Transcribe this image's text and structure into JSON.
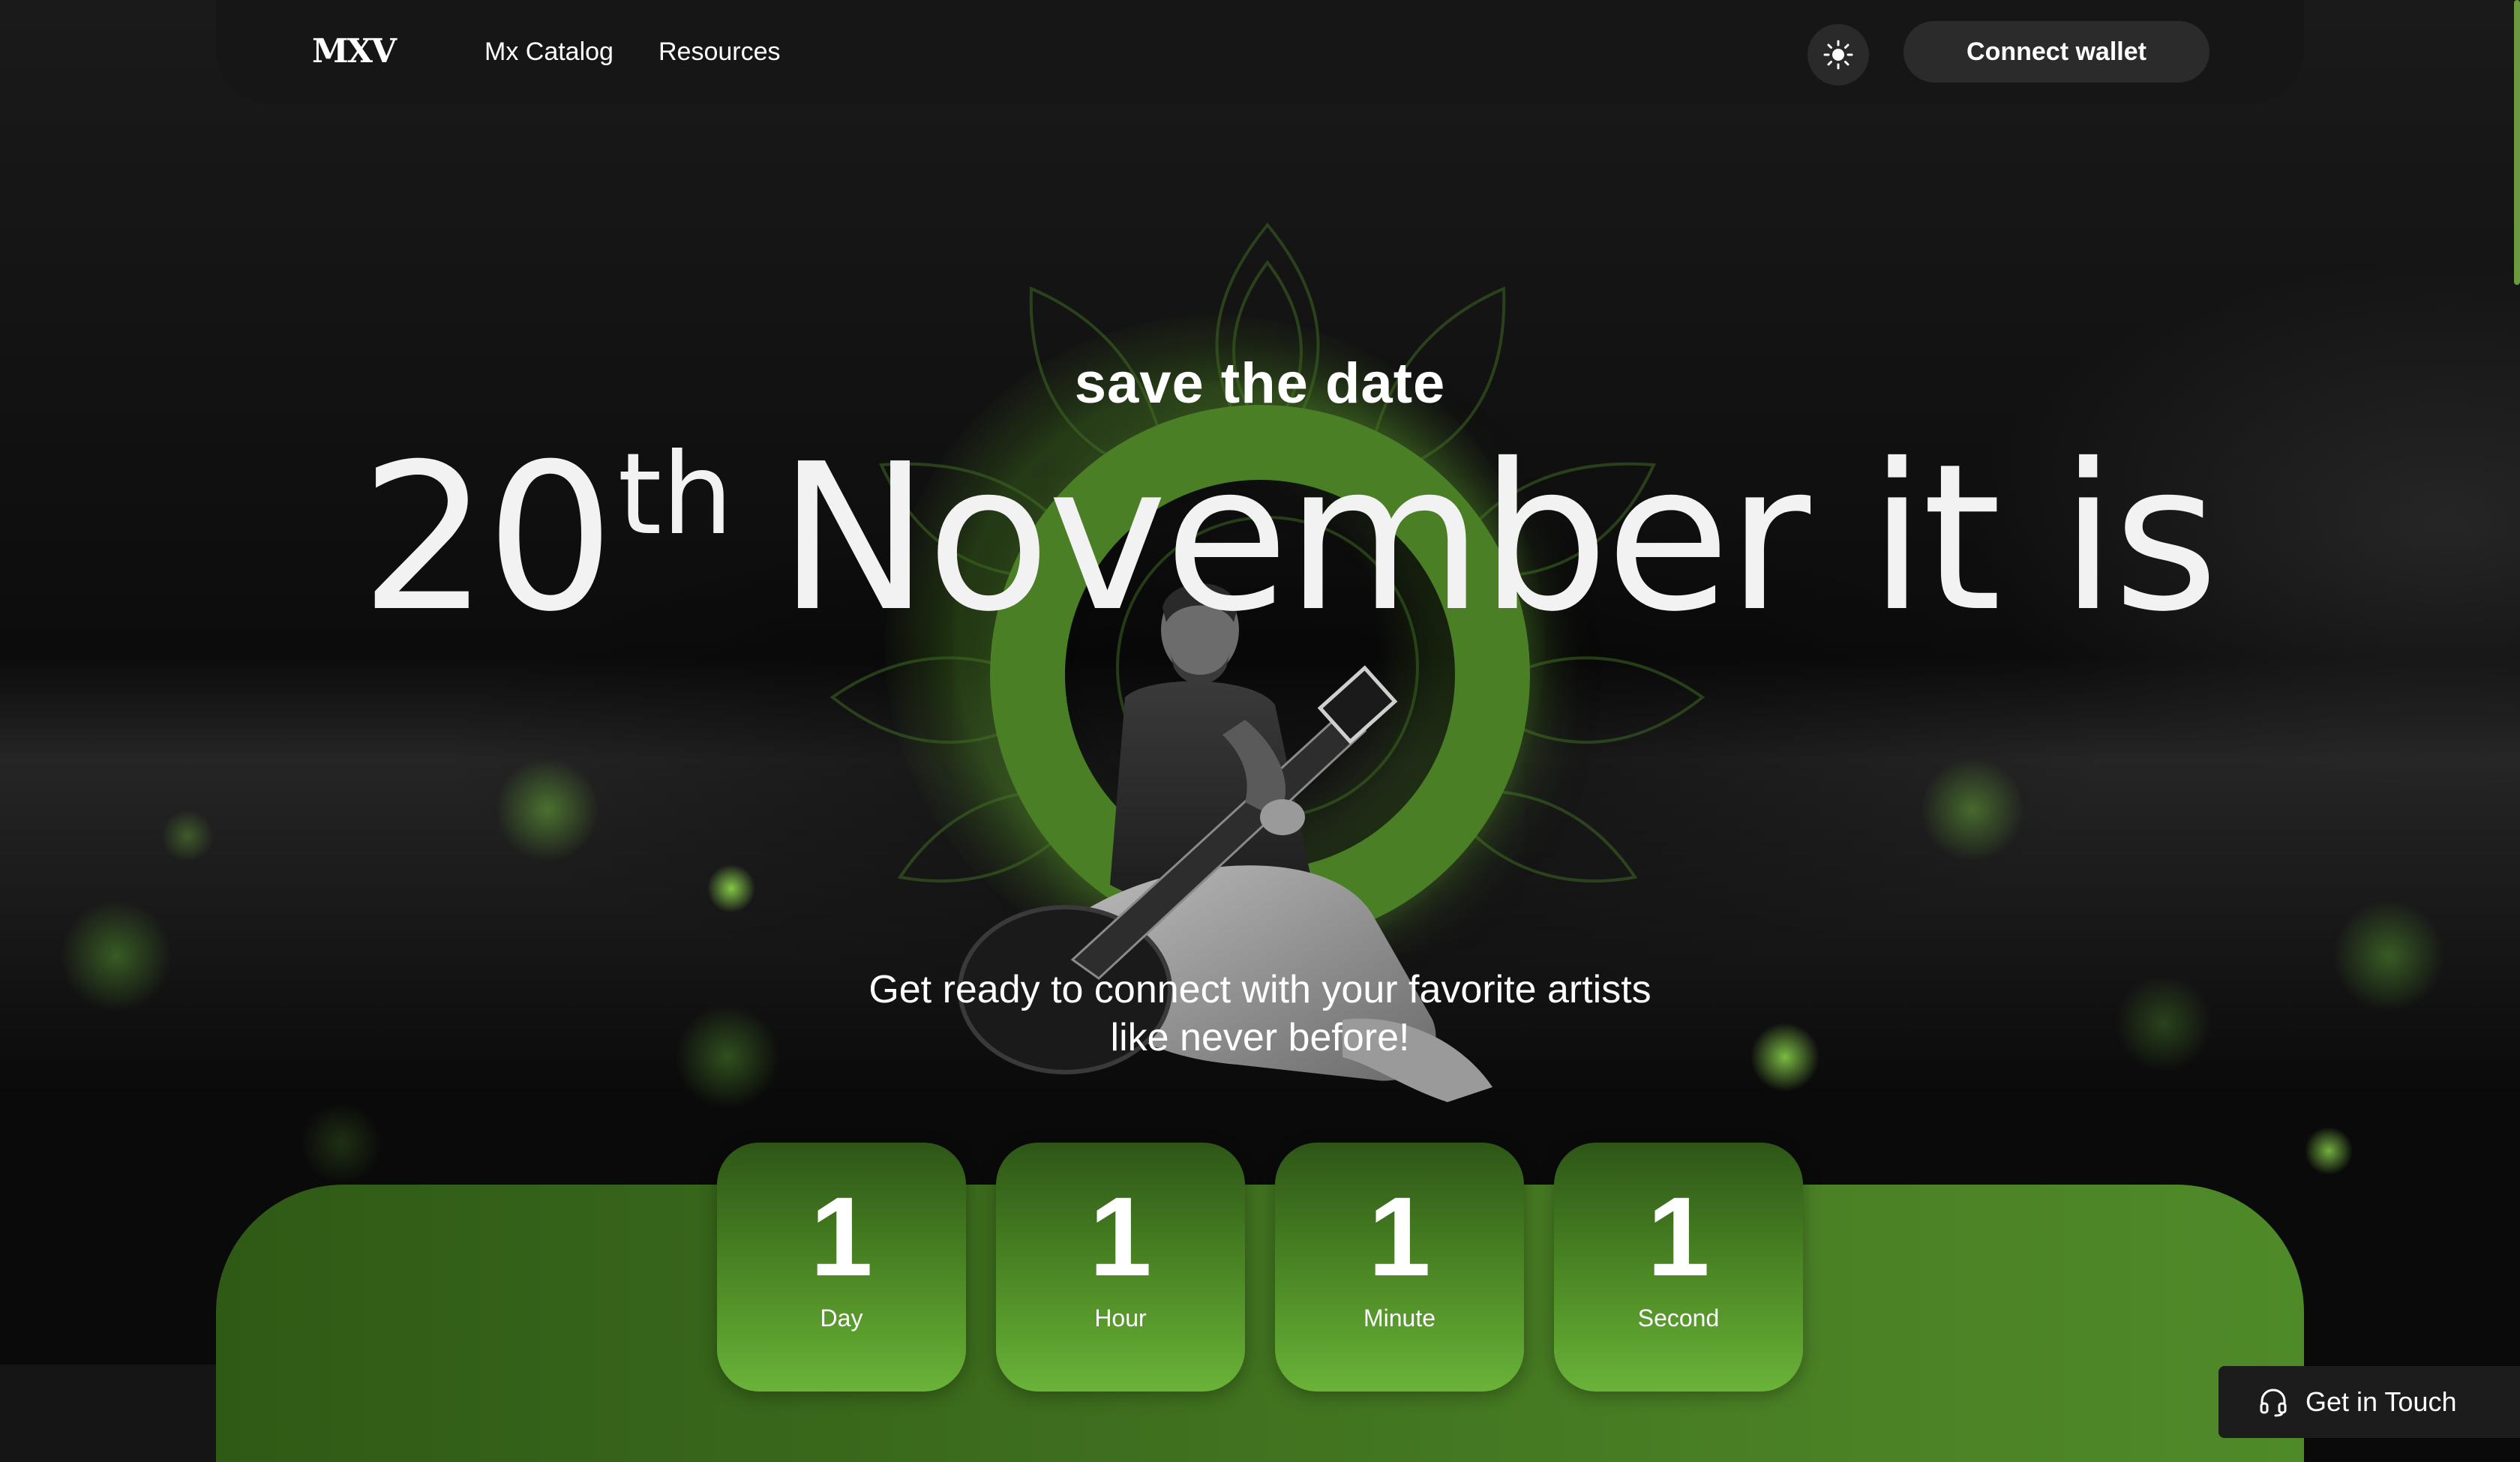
{
  "header": {
    "logo": "MXV",
    "nav": [
      "Mx Catalog",
      "Resources"
    ],
    "theme_toggle_icon": "sun-icon",
    "connect_wallet": "Connect wallet"
  },
  "hero": {
    "kicker": "save the date",
    "day": "20",
    "day_suffix": "th",
    "rest": "November it is",
    "tagline_line1": "Get ready to connect with your favorite artists",
    "tagline_line2": "like never before!"
  },
  "countdown": [
    {
      "value": "1",
      "label": "Day"
    },
    {
      "value": "1",
      "label": "Hour"
    },
    {
      "value": "1",
      "label": "Minute"
    },
    {
      "value": "1",
      "label": "Second"
    }
  ],
  "contact": {
    "label": "Get in Touch",
    "icon": "headset-icon"
  },
  "colors": {
    "accent_green": "#4a7f25",
    "panel_green": "#3d6d1d",
    "button_dark": "#2b2b2b"
  }
}
